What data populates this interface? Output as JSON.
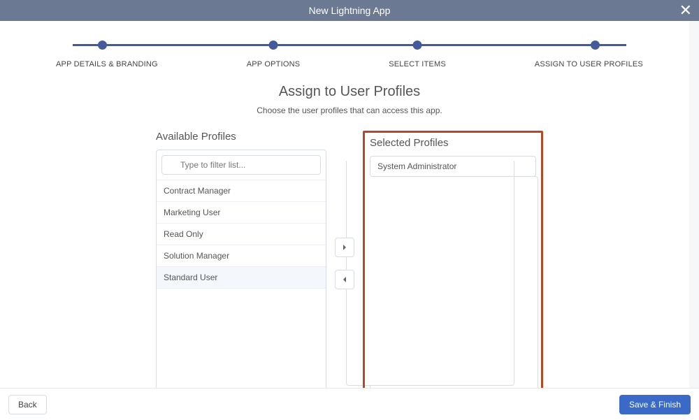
{
  "header": {
    "title": "New Lightning App"
  },
  "steps": {
    "s1": "APP DETAILS & BRANDING",
    "s2": "APP OPTIONS",
    "s3": "SELECT ITEMS",
    "s4": "ASSIGN TO USER PROFILES"
  },
  "page": {
    "title": "Assign to User Profiles",
    "subtitle": "Choose the user profiles that can access this app."
  },
  "available": {
    "title": "Available Profiles",
    "filter_placeholder": "Type to filter list...",
    "items": {
      "i0": "Contract Manager",
      "i1": "Marketing User",
      "i2": "Read Only",
      "i3": "Solution Manager",
      "i4": "Standard User"
    }
  },
  "selected": {
    "title": "Selected Profiles",
    "items": {
      "i0": "System Administrator"
    }
  },
  "footer": {
    "back": "Back",
    "save": "Save & Finish"
  }
}
